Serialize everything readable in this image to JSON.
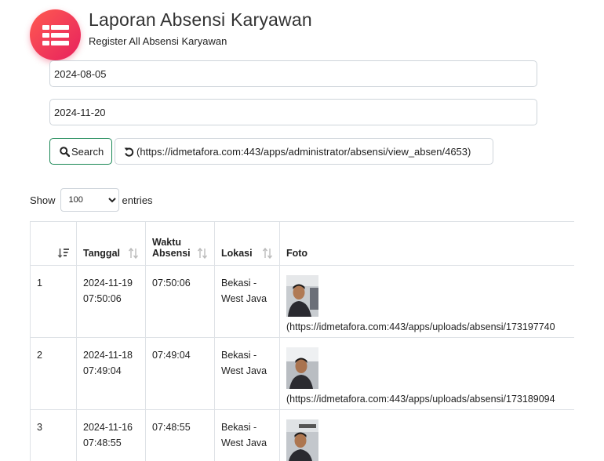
{
  "header": {
    "title": "Laporan Absensi Karyawan",
    "subtitle": "Register All Absensi Karyawan",
    "icon": "table-list-icon",
    "accent_color": "#f0385a"
  },
  "filters": {
    "date_from": "2024-08-05",
    "date_to": "2024-11-20",
    "search_label": "Search",
    "reset_label": "(https://idmetafora.com:443/apps/administrator/absensi/view_absen/4653)"
  },
  "entries": {
    "show_label": "Show",
    "selected": "100",
    "suffix": "entries"
  },
  "table": {
    "columns": [
      {
        "label": ""
      },
      {
        "label": "Tanggal"
      },
      {
        "label": "Waktu\nAbsensi"
      },
      {
        "label": "Lokasi"
      },
      {
        "label": "Foto"
      }
    ],
    "rows": [
      {
        "no": "1",
        "tanggal": "2024-11-19\n07:50:06",
        "waktu": "07:50:06",
        "lokasi": "Bekasi -\nWest Java",
        "foto": "(https://idmetafora.com:443/apps/uploads/absensi/173197740"
      },
      {
        "no": "2",
        "tanggal": "2024-11-18\n07:49:04",
        "waktu": "07:49:04",
        "lokasi": "Bekasi -\nWest Java",
        "foto": "(https://idmetafora.com:443/apps/uploads/absensi/173189094"
      },
      {
        "no": "3",
        "tanggal": "2024-11-16\n07:48:55",
        "waktu": "07:48:55",
        "lokasi": "Bekasi -\nWest Java",
        "foto": ""
      }
    ]
  }
}
